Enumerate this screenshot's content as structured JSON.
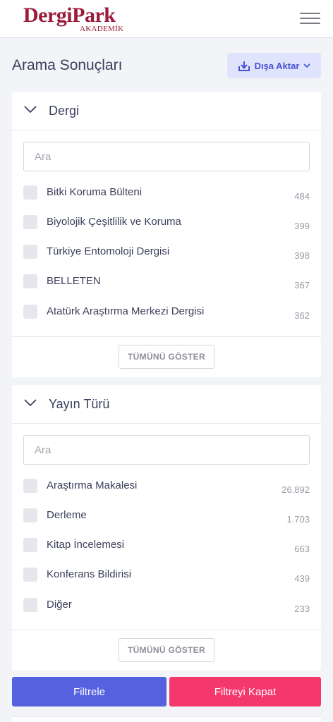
{
  "header": {
    "logo_brand": "DergiPark",
    "logo_sub": "AKADEMİK",
    "menu_icon": "hamburger-icon"
  },
  "page": {
    "title": "Arama Sonuçları",
    "export_label": "Dışa Aktar",
    "export_icon": "download-icon",
    "export_chevron_icon": "chevron-down-icon"
  },
  "filters": [
    {
      "title": "Dergi",
      "search_placeholder": "Ara",
      "search_value": "",
      "items": [
        {
          "label": "Bitki Koruma Bülteni",
          "count": "484"
        },
        {
          "label": "Biyolojik Çeşitlilik ve Koruma",
          "count": "399"
        },
        {
          "label": "Türkiye Entomoloji Dergisi",
          "count": "398"
        },
        {
          "label": "BELLETEN",
          "count": "367"
        },
        {
          "label": "Atatürk Araştırma Merkezi Dergisi",
          "count": "362"
        }
      ],
      "show_all_label": "TÜMÜNÜ GÖSTER"
    },
    {
      "title": "Yayın Türü",
      "search_placeholder": "Ara",
      "search_value": "",
      "items": [
        {
          "label": "Araştırma Makalesi",
          "count": "26.892"
        },
        {
          "label": "Derleme",
          "count": "1.703"
        },
        {
          "label": "Kitap İncelemesi",
          "count": "663"
        },
        {
          "label": "Konferans Bildirisi",
          "count": "439"
        },
        {
          "label": "Diğer",
          "count": "233"
        }
      ],
      "show_all_label": "TÜMÜNÜ GÖSTER"
    }
  ],
  "actions": {
    "filter_label": "Filtrele",
    "close_label": "Filtreyi Kapat"
  },
  "colors": {
    "brand": "#9b1b3a",
    "primary": "#5661e0",
    "danger": "#f5386c",
    "export_bg": "#dfe3fb"
  }
}
